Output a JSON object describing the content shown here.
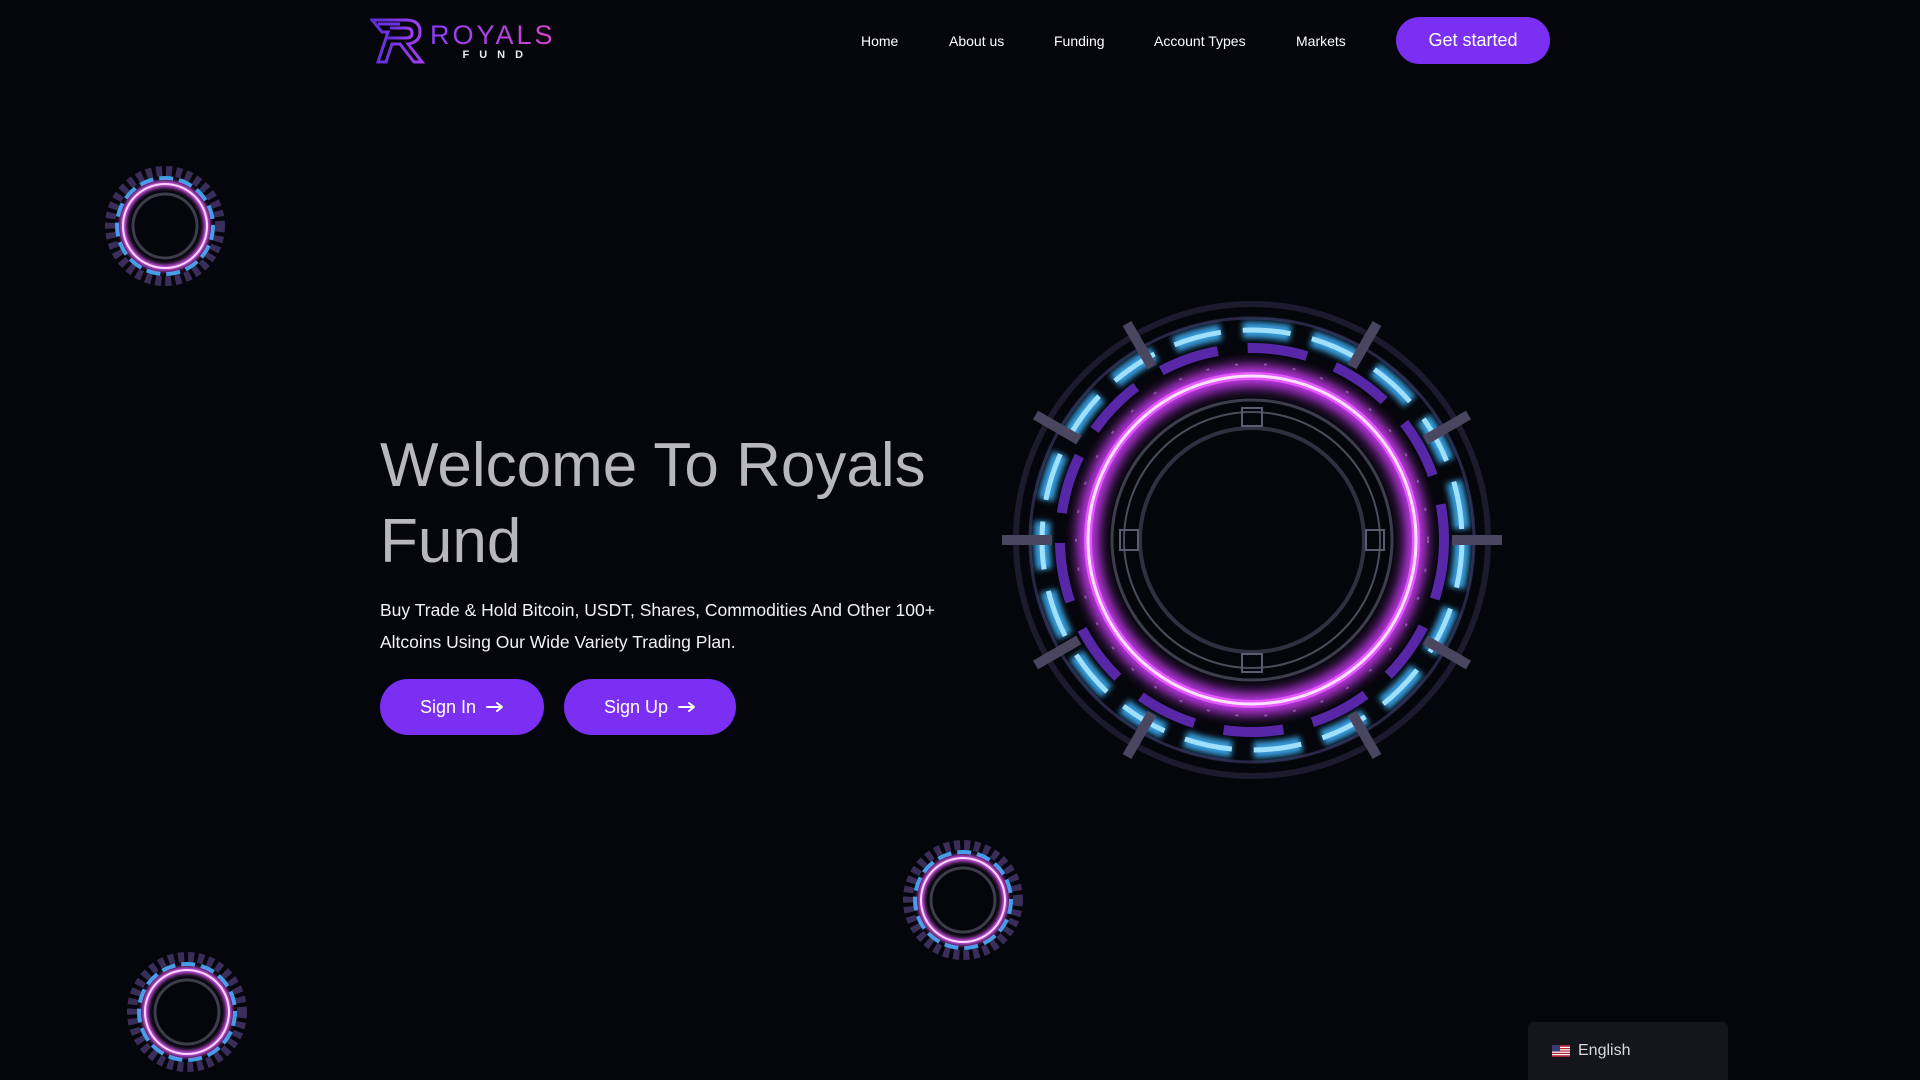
{
  "brand": {
    "name_top": "ROYALS",
    "name_bottom": "FUND",
    "accent": "#7b2ff2"
  },
  "nav": {
    "items": [
      {
        "label": "Home"
      },
      {
        "label": "About us"
      },
      {
        "label": "Funding"
      },
      {
        "label": "Account Types"
      },
      {
        "label": "Markets"
      }
    ],
    "cta_label": "Get started"
  },
  "hero": {
    "title": "Welcome To Royals Fund",
    "subtitle": "Buy Trade & Hold Bitcoin, USDT, Shares, Commodities And Other 100+ Altcoins Using Our Wide Variety Trading Plan.",
    "signin_label": "Sign In",
    "signup_label": "Sign Up",
    "arrow_icon": "arrow-right-icon"
  },
  "language": {
    "label": "English",
    "flag_icon": "us-flag-icon"
  },
  "colors": {
    "background": "#05060b",
    "button": "#7b2ff2",
    "ring_pink": "#e35bff",
    "ring_cyan": "#3fb6ff"
  }
}
